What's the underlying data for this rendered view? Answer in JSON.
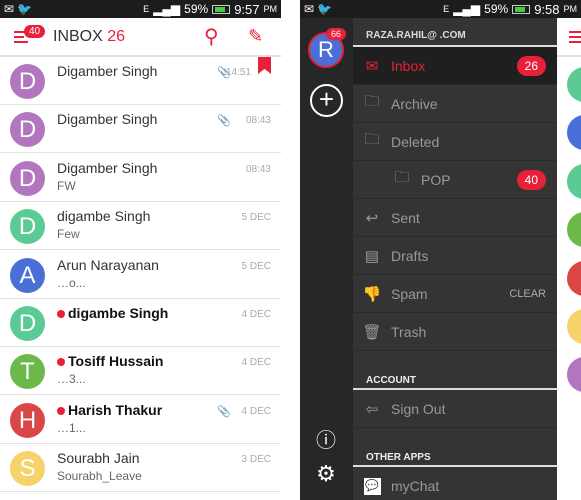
{
  "left_screen": {
    "status": {
      "time": "9:57",
      "ampm": "PM",
      "battery": "59%",
      "network": "E"
    },
    "header": {
      "menu_badge": "40",
      "title": "INBOX",
      "count": "26"
    },
    "messages": [
      {
        "initial": "D",
        "color": "#b276be",
        "sender": "Digamber Singh",
        "preview": "",
        "date": "14:51",
        "attachment": true,
        "flagged": true,
        "unread": false
      },
      {
        "initial": "D",
        "color": "#b276be",
        "sender": "Digamber Singh",
        "preview": "",
        "date": "08:43",
        "attachment": true,
        "flagged": false,
        "unread": false
      },
      {
        "initial": "D",
        "color": "#b276be",
        "sender": "Digamber Singh",
        "preview": "FW",
        "date": "08:43",
        "attachment": false,
        "flagged": false,
        "unread": false
      },
      {
        "initial": "D",
        "color": "#5cca95",
        "sender": "digambe Singh",
        "preview": "Few",
        "date": "5 DEC",
        "attachment": false,
        "flagged": false,
        "unread": false
      },
      {
        "initial": "A",
        "color": "#4a6fd6",
        "sender": "Arun Narayanan",
        "preview": "…o...",
        "date": "5 DEC",
        "attachment": false,
        "flagged": false,
        "unread": false
      },
      {
        "initial": "D",
        "color": "#5cca95",
        "sender": "digambe Singh",
        "preview": "",
        "date": "4 DEC",
        "attachment": false,
        "flagged": false,
        "unread": true
      },
      {
        "initial": "T",
        "color": "#6cb84a",
        "sender": "Tosiff Hussain",
        "preview": "…3...",
        "date": "4 DEC",
        "attachment": false,
        "flagged": false,
        "unread": true
      },
      {
        "initial": "H",
        "color": "#d94747",
        "sender": "Harish Thakur",
        "preview": "…1...",
        "date": "4 DEC",
        "attachment": true,
        "flagged": false,
        "unread": true
      },
      {
        "initial": "S",
        "color": "#f5d36a",
        "sender": "Sourabh Jain",
        "preview": "Sourabh_Leave",
        "date": "3 DEC",
        "attachment": false,
        "flagged": false,
        "unread": false
      }
    ]
  },
  "right_screen": {
    "status": {
      "time": "9:58",
      "ampm": "PM",
      "battery": "59%",
      "network": "E"
    },
    "account": {
      "initial": "R",
      "badge": "66",
      "email": "RAZA.RAHIL@                    .COM"
    },
    "folders": [
      {
        "label": "Inbox",
        "icon": "envelope-icon",
        "count": "26",
        "selected": true
      },
      {
        "label": "Archive",
        "icon": "folder-icon"
      },
      {
        "label": "Deleted",
        "icon": "folder-icon"
      },
      {
        "label": "POP",
        "icon": "folder-icon",
        "count": "40",
        "indent": true
      },
      {
        "label": "Sent",
        "icon": "reply-icon"
      },
      {
        "label": "Drafts",
        "icon": "document-icon"
      },
      {
        "label": "Spam",
        "icon": "thumbs-down-icon",
        "action": "CLEAR"
      },
      {
        "label": "Trash",
        "icon": "trash-icon"
      }
    ],
    "account_section": "ACCOUNT",
    "sign_out": "Sign Out",
    "other_apps_section": "OTHER APPS",
    "mychat": "myChat",
    "accent": "#e8203a"
  }
}
